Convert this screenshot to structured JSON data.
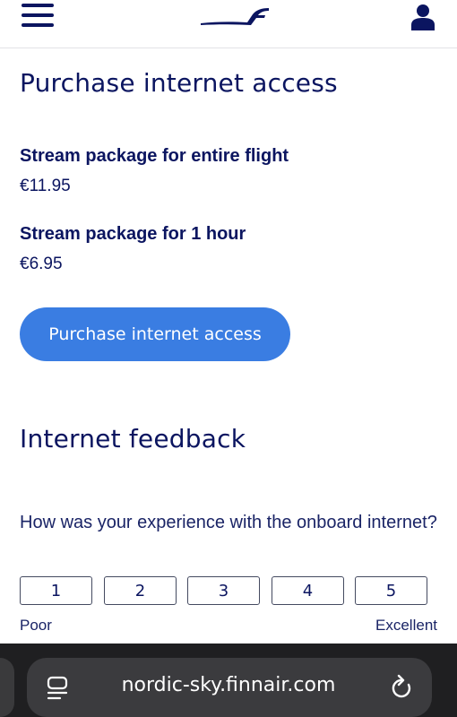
{
  "header": {
    "menu_icon": "hamburger-menu-icon",
    "logo_icon": "finnair-logo",
    "user_icon": "user-icon"
  },
  "purchase": {
    "title": "Purchase internet access",
    "packages": [
      {
        "name": "Stream package for entire flight",
        "price": "€11.95"
      },
      {
        "name": "Stream package for 1 hour",
        "price": "€6.95"
      }
    ],
    "button_label": "Purchase internet access"
  },
  "feedback": {
    "title": "Internet feedback",
    "question": "How was your experience with the onboard internet?",
    "ratings": [
      "1",
      "2",
      "3",
      "4",
      "5"
    ],
    "low_label": "Poor",
    "high_label": "Excellent"
  },
  "browser": {
    "url": "nordic-sky.finnair.com",
    "reader_icon": "reader-mode-icon",
    "reload_icon": "reload-icon"
  },
  "colors": {
    "brand_navy": "#0b1560",
    "button_blue": "#3a7de2",
    "browser_bar": "#1f1f21"
  }
}
